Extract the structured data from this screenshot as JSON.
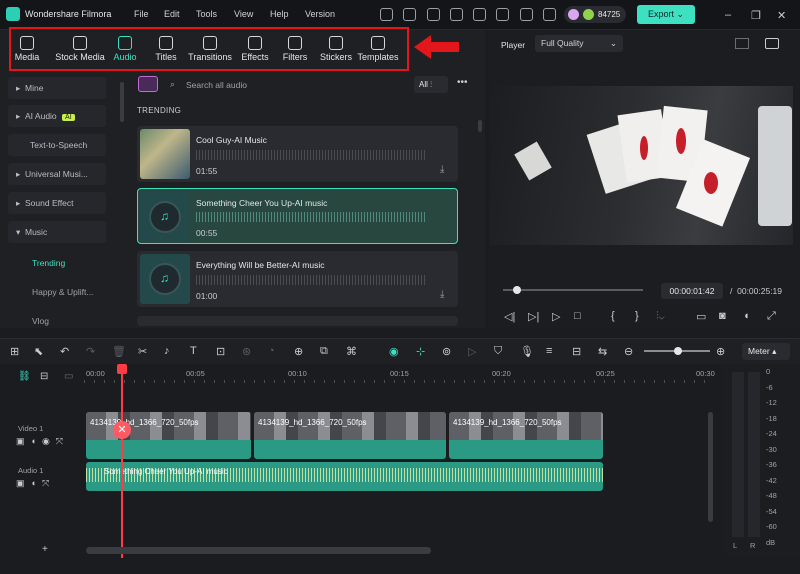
{
  "app": {
    "title": "Wondershare Filmora",
    "credits": "84725",
    "export_label": "Export"
  },
  "menu": [
    "File",
    "Edit",
    "Tools",
    "View",
    "Help",
    "Version"
  ],
  "tabs": [
    {
      "label": "Media"
    },
    {
      "label": "Stock Media"
    },
    {
      "label": "Audio",
      "active": true
    },
    {
      "label": "Titles"
    },
    {
      "label": "Transitions"
    },
    {
      "label": "Effects"
    },
    {
      "label": "Filters"
    },
    {
      "label": "Stickers"
    },
    {
      "label": "Templates"
    }
  ],
  "sidebar": {
    "items": [
      "Mine",
      "AI Audio",
      "Text-to-Speech",
      "Universal Musi...",
      "Sound Effect",
      "Music"
    ],
    "ai_badge": "AI",
    "subitems": [
      "Trending",
      "Happy & Uplift...",
      "Vlog"
    ]
  },
  "search": {
    "placeholder": "Search all audio",
    "filter_label": "All"
  },
  "section_title": "TRENDING",
  "tracks": [
    {
      "title": "Cool Guy-AI Music",
      "duration": "01:55"
    },
    {
      "title": "Something Cheer You Up-AI music",
      "duration": "00:55",
      "selected": true
    },
    {
      "title": "Everything Will be Better-AI music",
      "duration": "01:00"
    }
  ],
  "player": {
    "label": "Player",
    "quality": "Full Quality",
    "current_time": "00:00:01:42",
    "separator": "/",
    "total_time": "00:00:25:19"
  },
  "timeline": {
    "meter_label": "Meter",
    "ruler": [
      "00:00",
      "00:05",
      "00:10",
      "00:15",
      "00:20",
      "00:25",
      "00:30"
    ],
    "tracks": {
      "video": "Video 1",
      "audio": "Audio 1"
    },
    "clips": [
      "4134139_hd_1366_720_50fps",
      "4134139_hd_1366_720_50fps",
      "4134139_hd_1366_720_50fps"
    ],
    "audio_clip": "Something Cheer You Up-AI music",
    "meter_scale": [
      "0",
      "-6",
      "-12",
      "-18",
      "-24",
      "-30",
      "-36",
      "-42",
      "-48",
      "-54",
      "-60",
      "dB"
    ],
    "meter_channels": [
      "L",
      "R"
    ]
  },
  "colors": {
    "accent": "#3ee0c2",
    "annotation": "#e2161b",
    "playhead": "#ff3b45"
  }
}
